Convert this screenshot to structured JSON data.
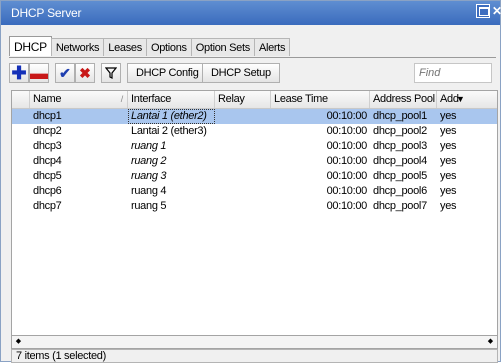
{
  "window": {
    "title": "DHCP Server"
  },
  "tabs": [
    "DHCP",
    "Networks",
    "Leases",
    "Options",
    "Option Sets",
    "Alerts"
  ],
  "toolbar": {
    "dhcp_config": "DHCP Config",
    "dhcp_setup": "DHCP Setup",
    "find_placeholder": "Find"
  },
  "table": {
    "columns": [
      "Name",
      "Interface",
      "Relay",
      "Lease Time",
      "Address Pool",
      "Add"
    ],
    "rows": [
      {
        "name": "dhcp1",
        "interface": "Lantai 1 (ether2)",
        "relay": "",
        "lease_time": "00:10:00",
        "address_pool": "dhcp_pool1",
        "add": "yes",
        "selected": true,
        "italic": true
      },
      {
        "name": "dhcp2",
        "interface": "Lantai 2 (ether3)",
        "relay": "",
        "lease_time": "00:10:00",
        "address_pool": "dhcp_pool2",
        "add": "yes",
        "selected": false,
        "italic": false
      },
      {
        "name": "dhcp3",
        "interface": "ruang 1",
        "relay": "",
        "lease_time": "00:10:00",
        "address_pool": "dhcp_pool3",
        "add": "yes",
        "selected": false,
        "italic": true
      },
      {
        "name": "dhcp4",
        "interface": "ruang 2",
        "relay": "",
        "lease_time": "00:10:00",
        "address_pool": "dhcp_pool4",
        "add": "yes",
        "selected": false,
        "italic": true
      },
      {
        "name": "dhcp5",
        "interface": "ruang 3",
        "relay": "",
        "lease_time": "00:10:00",
        "address_pool": "dhcp_pool5",
        "add": "yes",
        "selected": false,
        "italic": true
      },
      {
        "name": "dhcp6",
        "interface": "ruang 4",
        "relay": "",
        "lease_time": "00:10:00",
        "address_pool": "dhcp_pool6",
        "add": "yes",
        "selected": false,
        "italic": false
      },
      {
        "name": "dhcp7",
        "interface": "ruang 5",
        "relay": "",
        "lease_time": "00:10:00",
        "address_pool": "dhcp_pool7",
        "add": "yes",
        "selected": false,
        "italic": false
      }
    ]
  },
  "status": {
    "text": "7 items (1 selected)"
  },
  "colors": {
    "titlebar": "#3a6bbd",
    "selection": "#a9c6ee",
    "add_icon": "#1430b8",
    "remove_icon": "#c81818"
  },
  "icons": [
    "add-icon",
    "remove-icon",
    "enable-icon",
    "disable-icon",
    "filter-icon",
    "sort-icon",
    "scroll-left-icon",
    "scroll-right-icon"
  ]
}
